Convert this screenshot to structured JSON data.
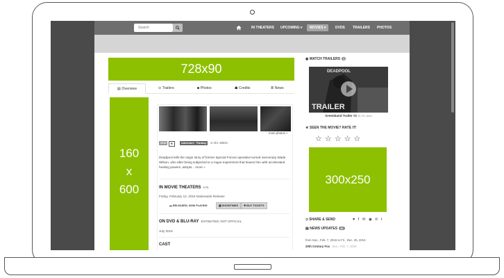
{
  "nav": {
    "search_placeholder": "Search",
    "items": [
      "IN THEATERS",
      "UPCOMING ▾",
      "MOVIES ▾",
      "DVDS",
      "TRAILERS",
      "PHOTOS"
    ]
  },
  "ads": {
    "leaderboard": "728x90",
    "skyscraper_w": "160",
    "skyscraper_x": "x",
    "skyscraper_h": "600",
    "medrect": "300x250"
  },
  "tabs": [
    "Overview",
    "Trailers",
    "Photos",
    "Credits",
    "News"
  ],
  "movie": {
    "more_photos": "more photos »",
    "badges": [
      "2016",
      "R",
      "Adventure",
      "Fantasy"
    ],
    "runtime": "⊙ 1hr, 48min",
    "description": "Deadpool tells the origin story of former Special Forces operative turned mercenary Wade Wilson, who after being subjected to a rogue experiment that leaves him with accelerated healing powers, adopts... more »",
    "theaters_title": "IN MOVIE THEATERS",
    "theaters_sub": "U.S.",
    "theaters_date": "Friday, February 12, 2016   Nationwide Release",
    "released_label": "RELEASED; NOW PLAYING",
    "showtimes_label": "SHOWTIMES",
    "tickets_label": "BUY TICKETS",
    "dvd_title": "ON DVD & BLU-RAY",
    "dvd_sub": "ESTIMATED; NOT OFFICIAL",
    "dvd_date": "July 2016",
    "cast_title": "CAST"
  },
  "sidebar": {
    "watch_trailers": "WATCH TRAILERS",
    "trailer_count": "5",
    "trailer_logo": "DEADPOOL",
    "trailer_overlay": "TRAILER",
    "trailer_caption": "Greenband Trailer #2",
    "trailer_views": "26,701 views",
    "rate_label": "SEEN THE MOVIE? RATE IT!",
    "stars": "☆☆☆☆☆",
    "share_label": "SHARE & SEND",
    "share_icons": "♥ f ✉ ◉ ℗ t",
    "news_label": "NEWS UPDATES",
    "news_count": "40",
    "news_range": "from Sun., Feb. 7, 2016 to Fri., Dec. 25, 2015",
    "news_item_source": "20th Century Fox",
    "news_item_date": "Sun., Feb. 7, 2016"
  }
}
